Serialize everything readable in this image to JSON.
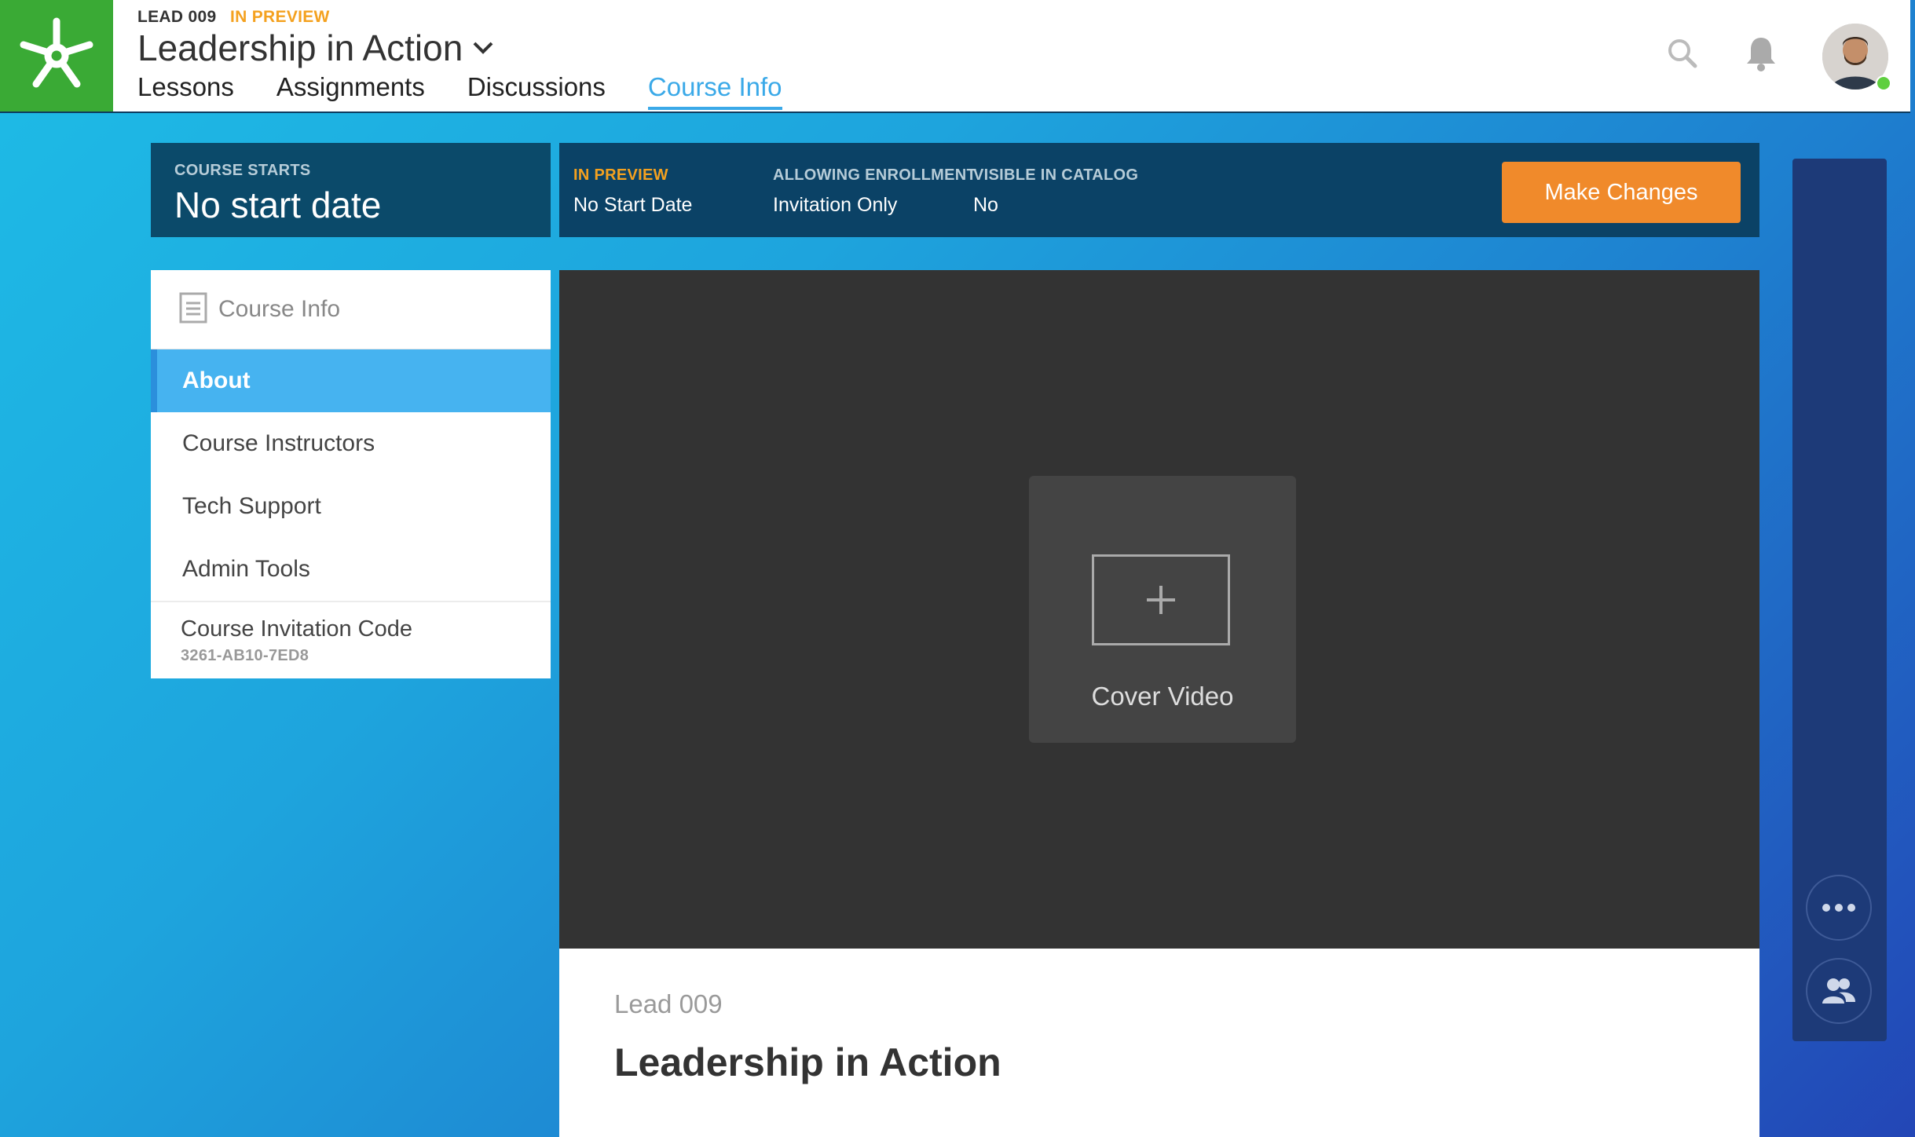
{
  "header": {
    "course_code": "LEAD 009",
    "course_status": "IN PREVIEW",
    "course_title": "Leadership in Action",
    "tabs": [
      {
        "label": "Lessons",
        "active": false
      },
      {
        "label": "Assignments",
        "active": false
      },
      {
        "label": "Discussions",
        "active": false
      },
      {
        "label": "Course Info",
        "active": true
      }
    ],
    "icons": [
      "logo-icon",
      "search-icon",
      "bell-icon",
      "chevron-down-icon"
    ]
  },
  "status_bar": {
    "starts_label": "COURSE STARTS",
    "starts_value": "No start date",
    "preview_label": "IN PREVIEW",
    "preview_value": "No Start Date",
    "enrollment_label": "ALLOWING ENROLLMENT",
    "enrollment_value": "Invitation Only",
    "catalog_label": "VISIBLE IN CATALOG",
    "catalog_value": "No",
    "make_changes_label": "Make Changes"
  },
  "sidebar": {
    "heading": "Course Info",
    "items": [
      {
        "label": "About",
        "active": true
      },
      {
        "label": "Course Instructors",
        "active": false
      },
      {
        "label": "Tech Support",
        "active": false
      },
      {
        "label": "Admin Tools",
        "active": false
      }
    ],
    "invitation_label": "Course Invitation Code",
    "invitation_code": "3261-AB10-7ED8"
  },
  "main": {
    "cover_label": "Cover Video",
    "course_code": "Lead 009",
    "course_title": "Leadership in Action"
  },
  "colors": {
    "brand_green": "#3aaa35",
    "accent_blue": "#3aa9e8",
    "preview_orange": "#f4a11f",
    "button_orange": "#f08a2b",
    "status_navy": "#0b4266"
  }
}
